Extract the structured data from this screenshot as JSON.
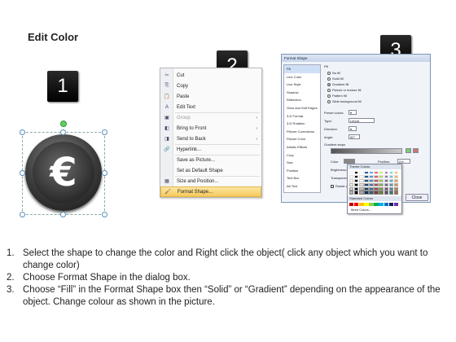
{
  "title": "Edit Color",
  "steps_badges": [
    "1",
    "2",
    "3"
  ],
  "menu": {
    "items": [
      {
        "icon": "cut-icon",
        "glyph": "✂",
        "label": "Cut",
        "arrow": "",
        "disabled": false,
        "highlight": false
      },
      {
        "icon": "copy-icon",
        "glyph": "⎘",
        "label": "Copy",
        "arrow": "",
        "disabled": false,
        "highlight": false
      },
      {
        "icon": "paste-icon",
        "glyph": "📋",
        "label": "Paste",
        "arrow": "",
        "disabled": false,
        "highlight": false
      },
      {
        "icon": "edit-text-icon",
        "glyph": "A",
        "label": "Edit Text",
        "arrow": "",
        "disabled": false,
        "highlight": false
      },
      {
        "icon": "group-icon",
        "glyph": "▣",
        "label": "Group",
        "arrow": "›",
        "disabled": true,
        "highlight": false
      },
      {
        "icon": "bring-front-icon",
        "glyph": "◧",
        "label": "Bring to Front",
        "arrow": "›",
        "disabled": false,
        "highlight": false
      },
      {
        "icon": "send-back-icon",
        "glyph": "◨",
        "label": "Send to Back",
        "arrow": "›",
        "disabled": false,
        "highlight": false
      },
      {
        "icon": "hyperlink-icon",
        "glyph": "🔗",
        "label": "Hyperlink...",
        "arrow": "",
        "disabled": false,
        "highlight": false
      },
      {
        "icon": "",
        "glyph": "",
        "label": "Save as Picture...",
        "arrow": "",
        "disabled": false,
        "highlight": false
      },
      {
        "icon": "",
        "glyph": "",
        "label": "Set as Default Shape",
        "arrow": "",
        "disabled": false,
        "highlight": false
      },
      {
        "icon": "size-position-icon",
        "glyph": "▦",
        "label": "Size and Position...",
        "arrow": "",
        "disabled": false,
        "highlight": false
      },
      {
        "icon": "format-shape-icon",
        "glyph": "🖌",
        "label": "Format Shape...",
        "arrow": "",
        "disabled": false,
        "highlight": true
      }
    ]
  },
  "dialog": {
    "title": "Format Shape",
    "nav": [
      "Fill",
      "Line Color",
      "Line Style",
      "Shadow",
      "Reflection",
      "Glow and Soft Edges",
      "3-D Format",
      "3-D Rotation",
      "Picture Corrections",
      "Picture Color",
      "Artistic Effects",
      "Crop",
      "Size",
      "Position",
      "Text Box",
      "Alt Text"
    ],
    "section": "Fill",
    "options": [
      "No fill",
      "Solid fill",
      "Gradient fill",
      "Picture or texture fill",
      "Pattern fill",
      "Slide background fill"
    ],
    "selected_option": "Gradient fill",
    "preset_label": "Preset colors:",
    "type_label": "Type:",
    "type_value": "Linear",
    "direction_label": "Direction:",
    "angle_label": "Angle:",
    "angle_value": "90°",
    "stops_label": "Gradient stops",
    "color_label": "Color",
    "position_label": "Position:",
    "position_value": "0%",
    "brightness_label": "Brightness:",
    "transparency_label": "Transparency:",
    "rotate_label": "Rotate with shape",
    "close_label": "Close"
  },
  "palette": {
    "theme_label": "Theme Colors",
    "standard_label": "Standard Colors",
    "more_label": "More Colors..."
  },
  "instructions": [
    {
      "n": "1.",
      "text": "Select the shape to change the color and Right click the object( click any object which you want to change color)"
    },
    {
      "n": "2.",
      "text": "Choose Format Shape in the dialog box."
    },
    {
      "n": "3.",
      "text": "Choose “Fill” in the Format Shape box then “Solid” or “Gradient” depending on the appearance of the object. Change colour as shown in the picture."
    }
  ]
}
